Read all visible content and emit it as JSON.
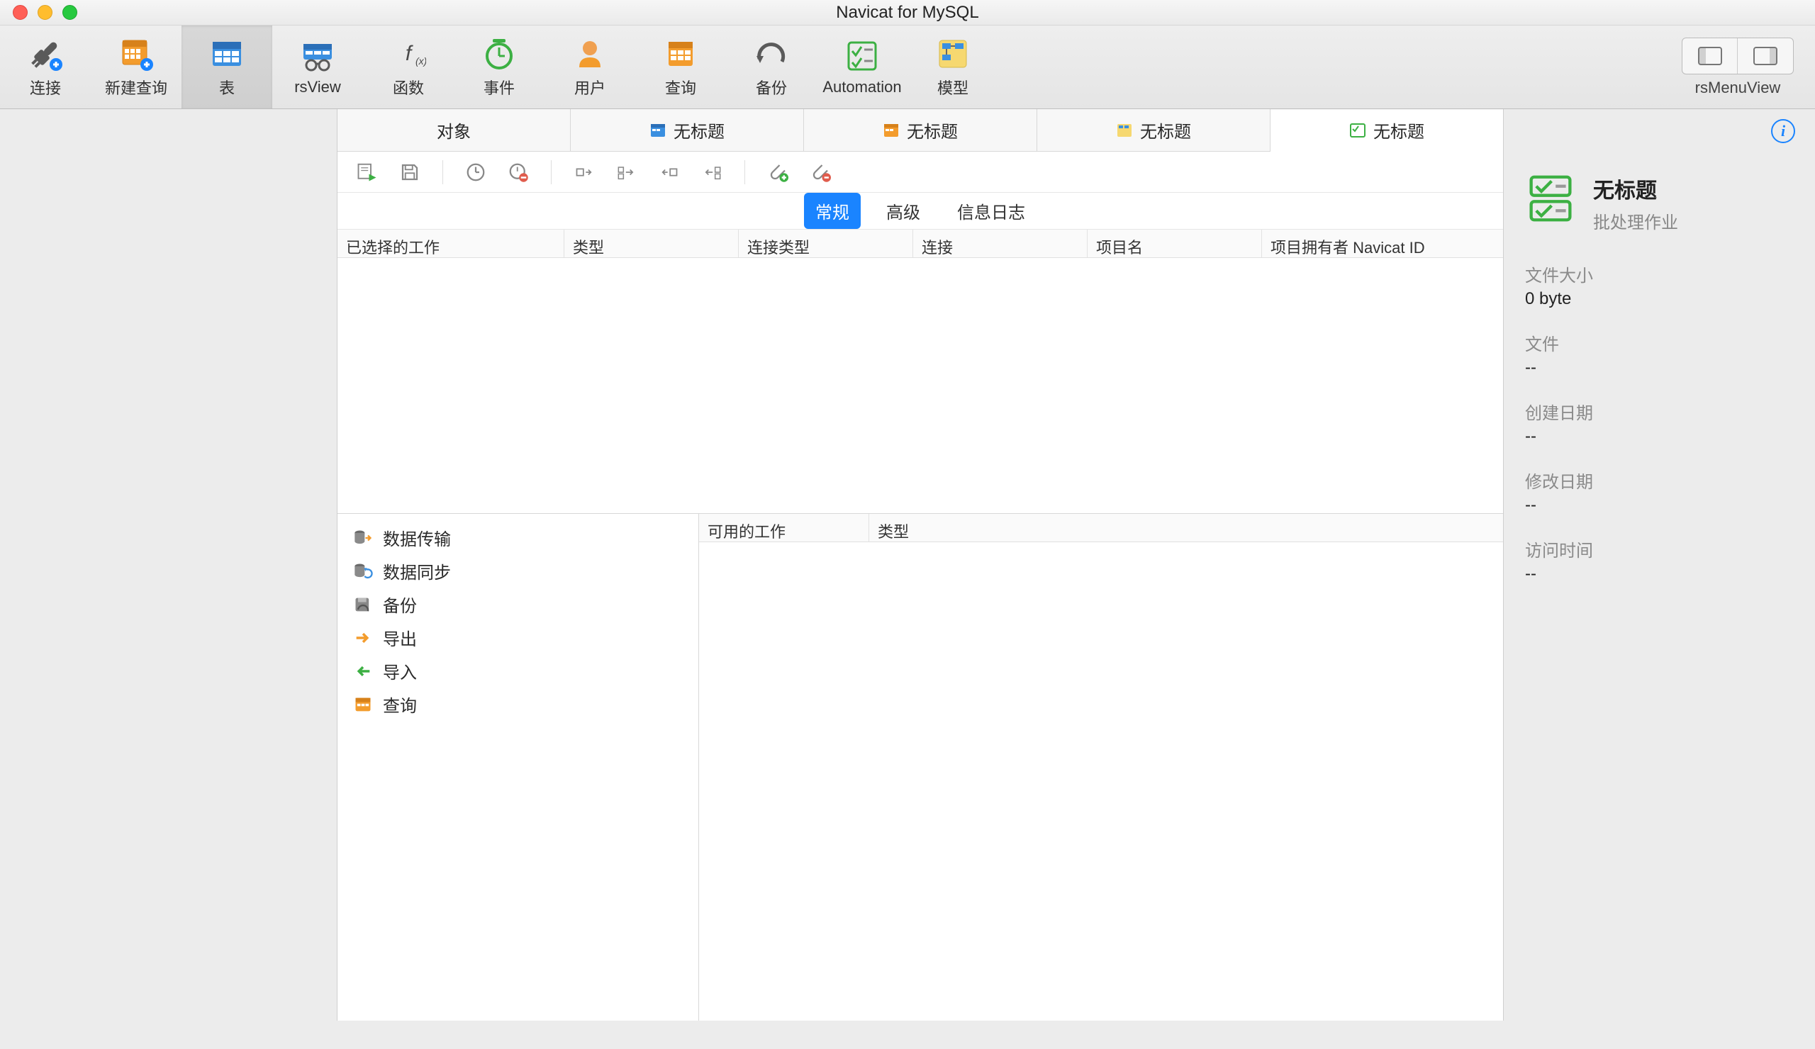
{
  "window": {
    "title": "Navicat for MySQL"
  },
  "toolbar": {
    "items": [
      {
        "label": "连接"
      },
      {
        "label": "新建查询"
      },
      {
        "label": "表"
      },
      {
        "label": "rsView"
      },
      {
        "label": "函数"
      },
      {
        "label": "事件"
      },
      {
        "label": "用户"
      },
      {
        "label": "查询"
      },
      {
        "label": "备份"
      },
      {
        "label": "Automation"
      },
      {
        "label": "模型"
      }
    ],
    "rsMenuViewLabel": "rsMenuView"
  },
  "tabs": [
    {
      "label": "对象"
    },
    {
      "label": "无标题"
    },
    {
      "label": "无标题"
    },
    {
      "label": "无标题"
    },
    {
      "label": "无标题"
    }
  ],
  "subtabs": {
    "general": "常规",
    "advanced": "高级",
    "infolog": "信息日志"
  },
  "upperColumns": {
    "c1": "已选择的工作",
    "c2": "类型",
    "c3": "连接类型",
    "c4": "连接",
    "c5": "项目名",
    "c6": "项目拥有者 Navicat ID"
  },
  "taskTypes": [
    "数据传输",
    "数据同步",
    "备份",
    "导出",
    "导入",
    "查询"
  ],
  "lowerColumns": {
    "c1": "可用的工作",
    "c2": "类型"
  },
  "inspector": {
    "title": "无标题",
    "subtitle": "批处理作业",
    "fileSizeLabel": "文件大小",
    "fileSizeValue": "0 byte",
    "fileLabel": "文件",
    "fileValue": "--",
    "createdLabel": "创建日期",
    "createdValue": "--",
    "modifiedLabel": "修改日期",
    "modifiedValue": "--",
    "accessLabel": "访问时间",
    "accessValue": "--"
  }
}
